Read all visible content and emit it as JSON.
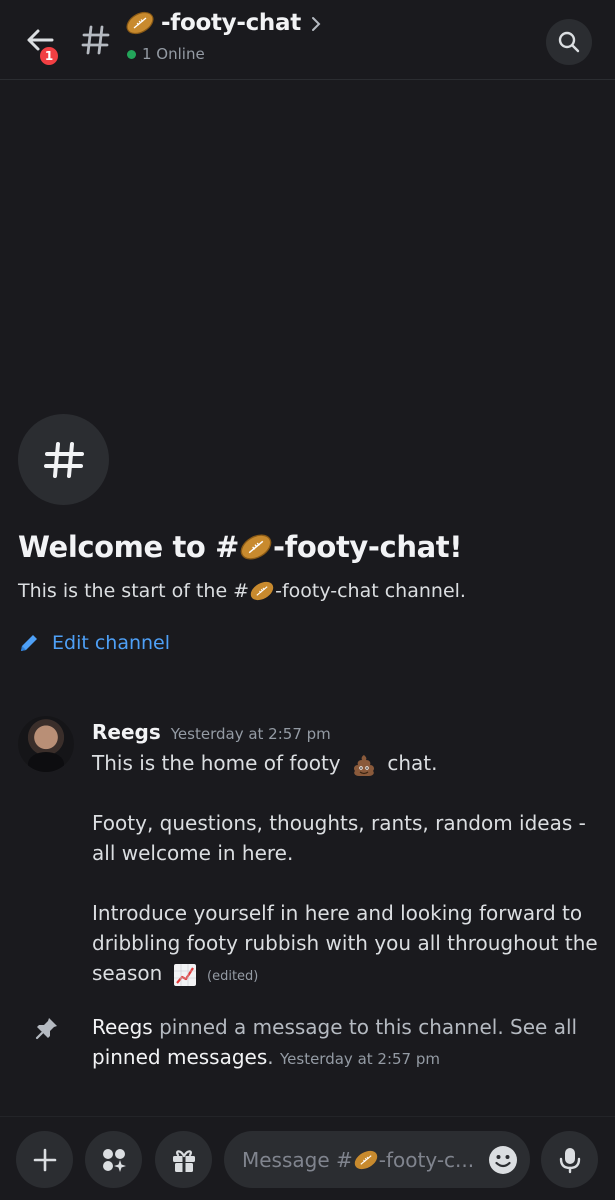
{
  "header": {
    "back_badge": "1",
    "channel_name": "-footy-chat",
    "online_text": "1 Online"
  },
  "welcome": {
    "title_prefix": "Welcome to #",
    "title_suffix": "-footy-chat!",
    "subtitle_prefix": "This is the start of the #",
    "subtitle_suffix": "-footy-chat channel.",
    "edit_label": "Edit channel"
  },
  "message": {
    "author": "Reegs",
    "timestamp": "Yesterday at 2:57 pm",
    "line1_a": "This is the home of footy",
    "line1_b": "chat.",
    "para2": "Footy, questions, thoughts, rants, random ideas - all welcome in here.",
    "para3": "Introduce yourself in here and looking forward to dribbling footy rubbish with you all throughout the season",
    "edited": "(edited)"
  },
  "pinned": {
    "author": "Reegs",
    "text": " pinned a message to this channel. See all ",
    "link": "pinned messages",
    "period": ".",
    "timestamp": "Yesterday at 2:57 pm"
  },
  "composer": {
    "placeholder_prefix": "Message #",
    "placeholder_suffix": "-footy-c..."
  },
  "icons": {
    "back": "arrow-left-icon",
    "channel": "hash-icon",
    "search": "search-icon",
    "edit": "pencil-icon",
    "pin": "pin-icon",
    "plus": "plus-icon",
    "apps": "apps-icon",
    "gift": "gift-icon",
    "emoji": "emoji-icon",
    "mic": "microphone-icon"
  },
  "colors": {
    "background": "#1a1a1e",
    "surface": "#2b2d31",
    "link": "#4ea0f7",
    "online": "#23a55a",
    "badge": "#f23f43"
  }
}
